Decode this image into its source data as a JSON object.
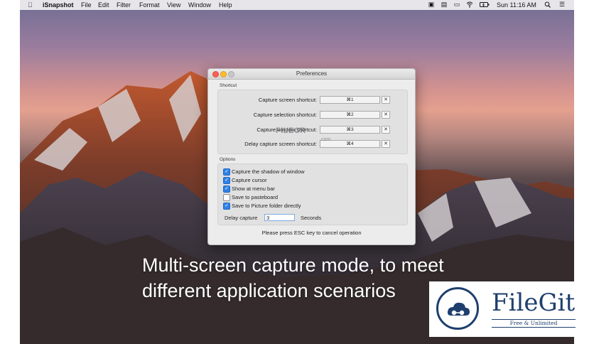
{
  "menubar": {
    "apple_icon": "apple-icon",
    "items": [
      "iSnapshot",
      "File",
      "Edit",
      "Filter",
      "Format",
      "View",
      "Window",
      "Help"
    ],
    "clock": "Sun 11:16 AM",
    "status_icons": [
      "camera-icon",
      "display-icon",
      "wifi-icon",
      "battery-icon",
      "search-icon",
      "list-icon"
    ]
  },
  "window": {
    "title": "Preferences",
    "shortcut_section": "Shortcut",
    "shortcuts": [
      {
        "label": "Capture screen shortcut:",
        "key": "⌘1"
      },
      {
        "label": "Capture selection shortcut:",
        "key": "⌘2"
      },
      {
        "label": "Capture window shortcut:",
        "key": "⌘3"
      },
      {
        "label": "Delay capture screen shortcut:",
        "key": "⌘4"
      }
    ],
    "clear_glyph": "✕",
    "options_section": "Options",
    "options": [
      {
        "label": "Capture the shadow of window",
        "checked": true
      },
      {
        "label": "Capture cursor",
        "checked": true
      },
      {
        "label": "Show at menu bar",
        "checked": true
      },
      {
        "label": "Save to pasteboard",
        "checked": false
      },
      {
        "label": "Save to Picture folder directly",
        "checked": true
      }
    ],
    "delay_label": "Delay capture",
    "delay_value": "3",
    "seconds_label": "Seconds",
    "hint": "Please press ESC key to cancel operation"
  },
  "watermark": {
    "text": "FILECR",
    "sub": ".com"
  },
  "caption": {
    "line1": "Multi-screen capture mode, to meet",
    "line2": "different application scenarios"
  },
  "badge": {
    "name": "FileGit",
    "tagline": "Free & Unlimited"
  },
  "colors": {
    "accent": "#2f82e8",
    "badge_blue": "#1e3f6e",
    "close": "#fc5f57",
    "minimize": "#fdbc2e",
    "zoom": "#c8c8c8"
  }
}
